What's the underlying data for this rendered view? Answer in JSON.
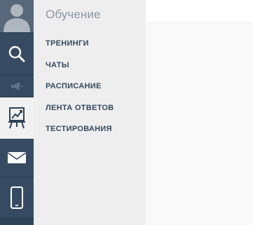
{
  "sidebar": {
    "items": [
      {
        "name": "user-avatar",
        "icon": "user-icon",
        "active": false
      },
      {
        "name": "search",
        "icon": "search-icon",
        "active": false
      },
      {
        "name": "announcements",
        "icon": "megaphone-icon",
        "active": false
      },
      {
        "name": "learning",
        "icon": "presentation-chart-icon",
        "active": true
      },
      {
        "name": "messages",
        "icon": "envelope-icon",
        "active": false
      },
      {
        "name": "mobile",
        "icon": "smartphone-icon",
        "active": false
      }
    ]
  },
  "panel": {
    "title": "Обучение",
    "menu": [
      {
        "label": "ТРЕНИНГИ"
      },
      {
        "label": "ЧАТЫ"
      },
      {
        "label": "РАСПИСАНИЕ"
      },
      {
        "label": "ЛЕНТА ОТВЕТОВ"
      },
      {
        "label": "ТЕСТИРОВАНИЯ"
      }
    ]
  },
  "colors": {
    "rail_bg": "#2f4257",
    "rail_item_bg": "#364b62",
    "panel_bg": "#eeeeee",
    "menu_text": "#34495e",
    "title_text": "#8b97a3"
  }
}
